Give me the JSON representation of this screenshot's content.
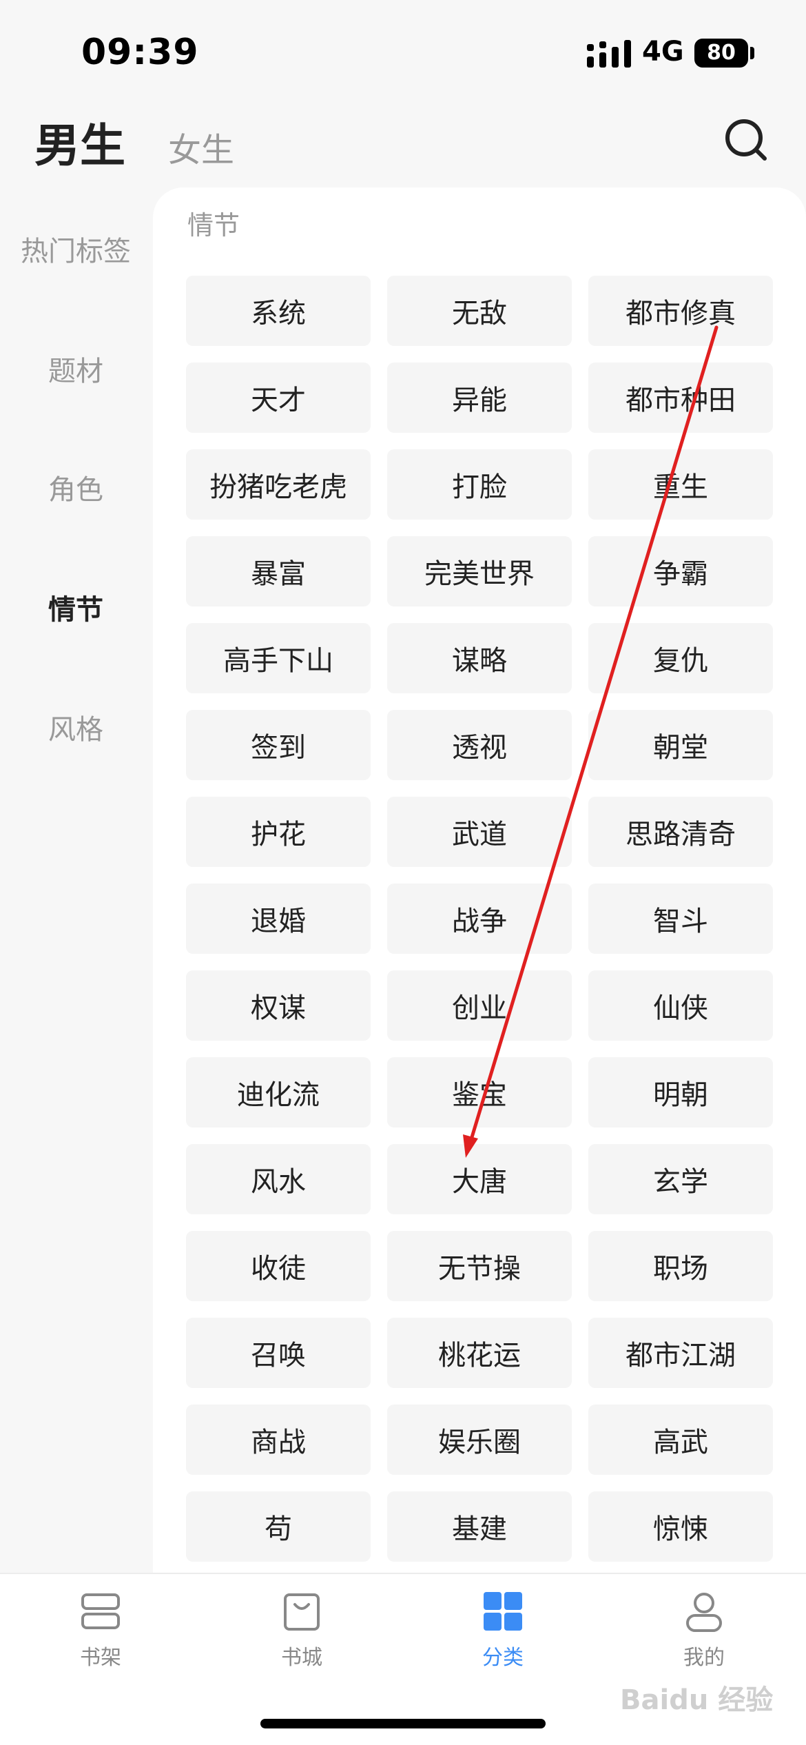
{
  "status_bar": {
    "time": "09:39",
    "network": "4G",
    "battery": "80"
  },
  "header": {
    "tab_male": "男生",
    "tab_female": "女生"
  },
  "sidebar": {
    "items": [
      {
        "label": "热门标签"
      },
      {
        "label": "题材"
      },
      {
        "label": "角色"
      },
      {
        "label": "情节"
      },
      {
        "label": "风格"
      }
    ],
    "active": "情节"
  },
  "main": {
    "section_title": "情节",
    "tags": [
      "系统",
      "无敌",
      "都市修真",
      "天才",
      "异能",
      "都市种田",
      "扮猪吃老虎",
      "打脸",
      "重生",
      "暴富",
      "完美世界",
      "争霸",
      "高手下山",
      "谋略",
      "复仇",
      "签到",
      "透视",
      "朝堂",
      "护花",
      "武道",
      "思路清奇",
      "退婚",
      "战争",
      "智斗",
      "权谋",
      "创业",
      "仙侠",
      "迪化流",
      "鉴宝",
      "明朝",
      "风水",
      "大唐",
      "玄学",
      "收徒",
      "无节操",
      "职场",
      "召唤",
      "桃花运",
      "都市江湖",
      "商战",
      "娱乐圈",
      "高武",
      "苟",
      "基建",
      "惊悚"
    ]
  },
  "bottom_nav": {
    "items": [
      {
        "label": "书架",
        "icon": "bookshelf-icon"
      },
      {
        "label": "书城",
        "icon": "bookstore-bag-icon"
      },
      {
        "label": "分类",
        "icon": "category-grid-icon"
      },
      {
        "label": "我的",
        "icon": "profile-icon"
      }
    ],
    "active": "分类"
  },
  "watermark": "Baidu 经验",
  "colors": {
    "accent": "#3b8cf5",
    "annotation_arrow": "#e02020"
  }
}
